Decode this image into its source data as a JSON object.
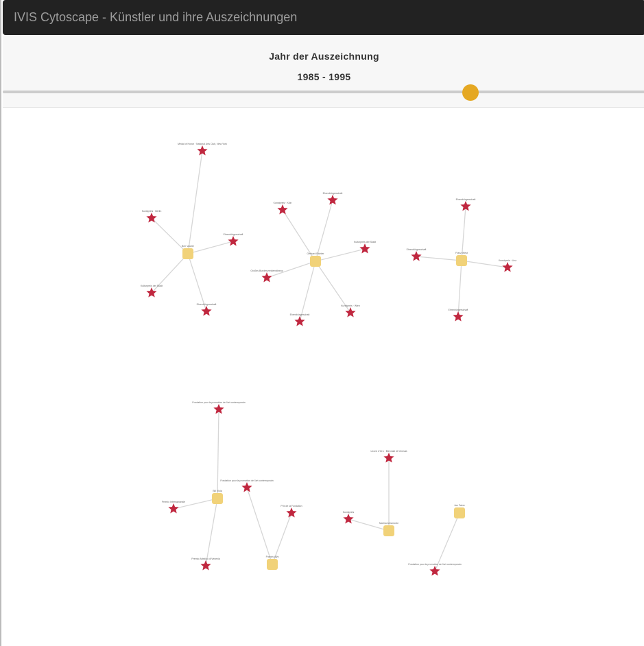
{
  "navbar": {
    "title": "IVIS Cytoscape - Künstler und ihre Auszeichnungen"
  },
  "filter": {
    "title": "Jahr der Auszeichnung",
    "range_label": "1985 - 1995"
  },
  "slider": {
    "min": 1985,
    "max": 1995,
    "value": 1995
  },
  "colors": {
    "artist": "#f1d279",
    "award": "#c0273f",
    "edge": "#d6d6d6",
    "slider_handle": "#e5a823"
  },
  "graph": {
    "artists": [
      {
        "id": "a1",
        "label": "Ben Vautier"
      },
      {
        "id": "a2",
        "label": "Gerhard Richter"
      },
      {
        "id": "a3",
        "label": "Franz West"
      },
      {
        "id": "a4",
        "label": "Bill Viola"
      },
      {
        "id": "a5",
        "label": "Francis Alÿs"
      },
      {
        "id": "a6",
        "label": "Marina Abramović"
      },
      {
        "id": "a7",
        "label": "Jan Fabre"
      }
    ],
    "awards": [
      {
        "id": "w1",
        "artist": "a1",
        "label": "Medal of Honor · National Arts Club, New York"
      },
      {
        "id": "w2",
        "artist": "a1",
        "label": "Kunstpreis · Berlin"
      },
      {
        "id": "w3",
        "artist": "a1",
        "label": "Ehrenbürgerschaft"
      },
      {
        "id": "w4",
        "artist": "a1",
        "label": "Kulturpreis der Stadt"
      },
      {
        "id": "w5",
        "artist": "a1",
        "label": "Ehrenbürgerschaft"
      },
      {
        "id": "w6",
        "artist": "a2",
        "label": "Ehrenbürgerschaft"
      },
      {
        "id": "w7",
        "artist": "a2",
        "label": "Kunstpreis · Köln"
      },
      {
        "id": "w8",
        "artist": "a2",
        "label": "Kulturpreis der Stadt"
      },
      {
        "id": "w9",
        "artist": "a2",
        "label": "Großes Bundesverdienstkreuz"
      },
      {
        "id": "w10",
        "artist": "a2",
        "label": "Kunstpreis · Wien"
      },
      {
        "id": "w11",
        "artist": "a2",
        "label": "Ehrenbürgerschaft"
      },
      {
        "id": "w12",
        "artist": "a3",
        "label": "Ehrenbürgerschaft"
      },
      {
        "id": "w13",
        "artist": "a3",
        "label": "Ehrenbürgerschaft"
      },
      {
        "id": "w14",
        "artist": "a3",
        "label": "Kunstpreis · Linz"
      },
      {
        "id": "w15",
        "artist": "a3",
        "label": "Ehrenbürgerschaft"
      },
      {
        "id": "w16",
        "artist": "a4",
        "label": "Fondation pour la promotion de l'art contemporain"
      },
      {
        "id": "w17",
        "artist": "a4",
        "label": "Premio Internazionale"
      },
      {
        "id": "w18",
        "artist": "a4",
        "label": "Premio Artistico di Venezia"
      },
      {
        "id": "w19",
        "artist": "a5",
        "label": "Fondation pour la promotion de l'art contemporain"
      },
      {
        "id": "w20",
        "artist": "a5",
        "label": "Prix de la Fondation"
      },
      {
        "id": "w21",
        "artist": "a6",
        "label": "Leone d'Oro · Biennale di Venezia"
      },
      {
        "id": "w22",
        "artist": "a6",
        "label": "Kunstpreis"
      },
      {
        "id": "w23",
        "artist": "a7",
        "label": "Fondation pour la promotion de l'art contemporain"
      }
    ]
  }
}
